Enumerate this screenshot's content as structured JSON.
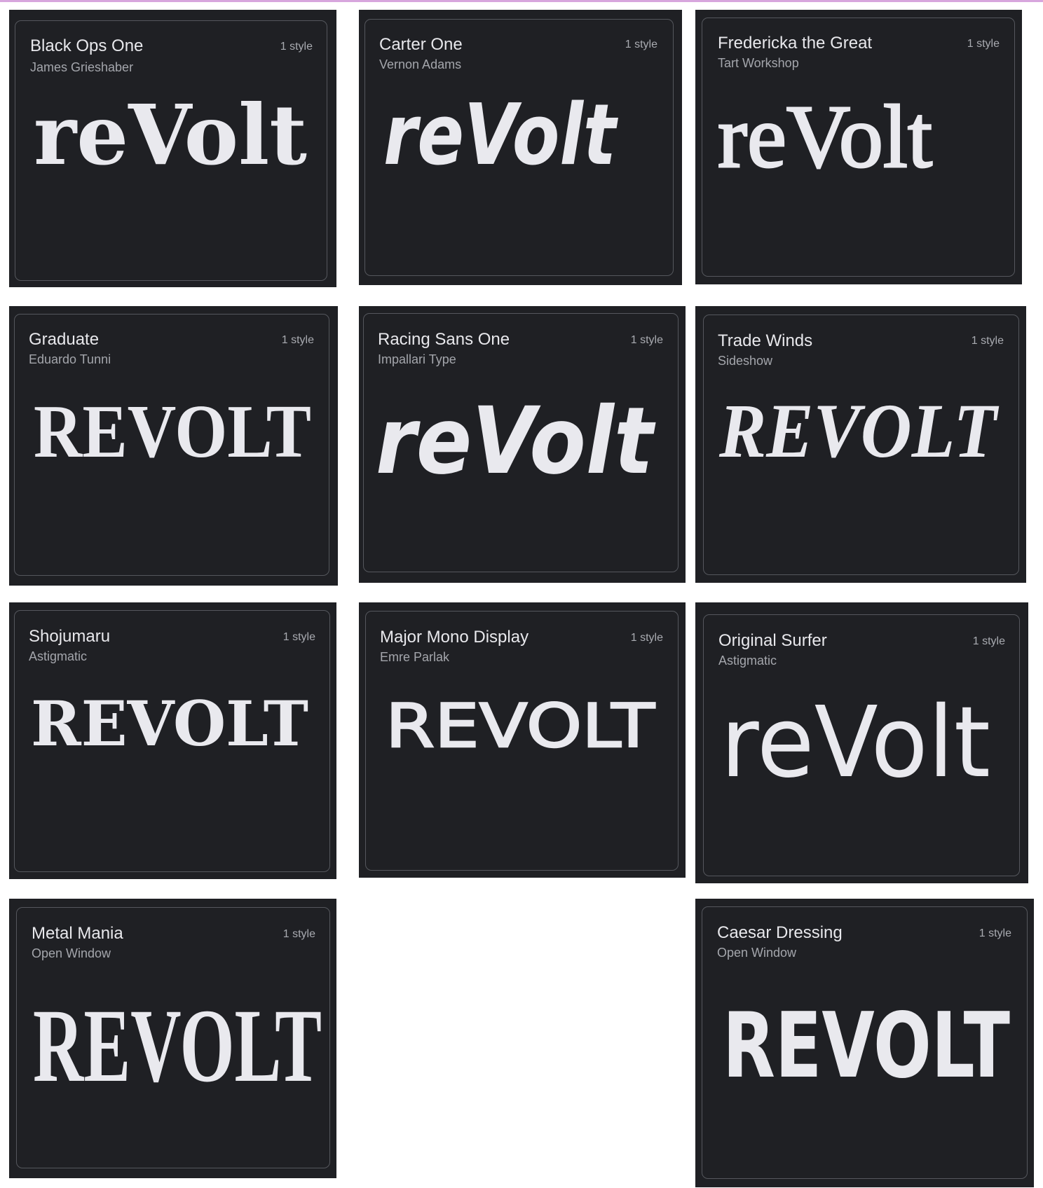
{
  "sample_text_lower": "reVolt",
  "sample_text_upper": "REVOLT",
  "colors": {
    "card_bg": "#1f2024",
    "border": "#55575d",
    "sample": "#e9e9ee",
    "accent_line": "#d7a6dd"
  },
  "fonts": [
    {
      "name": "Black Ops One",
      "author": "James Grieshaber",
      "styles": "1 style",
      "sample": "reVolt"
    },
    {
      "name": "Carter One",
      "author": "Vernon Adams",
      "styles": "1 style",
      "sample": "reVolt"
    },
    {
      "name": "Fredericka the Great",
      "author": "Tart Workshop",
      "styles": "1 style",
      "sample": "reVolt"
    },
    {
      "name": "Graduate",
      "author": "Eduardo Tunni",
      "styles": "1 style",
      "sample": "REVOLT"
    },
    {
      "name": "Racing Sans One",
      "author": "Impallari Type",
      "styles": "1 style",
      "sample": "reVolt"
    },
    {
      "name": "Trade Winds",
      "author": "Sideshow",
      "styles": "1 style",
      "sample": "REVOLT"
    },
    {
      "name": "Shojumaru",
      "author": "Astigmatic",
      "styles": "1 style",
      "sample": "REVOLT"
    },
    {
      "name": "Major Mono Display",
      "author": "Emre Parlak",
      "styles": "1 style",
      "sample": "REVOLT"
    },
    {
      "name": "Original Surfer",
      "author": "Astigmatic",
      "styles": "1 style",
      "sample": "reVolt"
    },
    {
      "name": "Metal Mania",
      "author": "Open Window",
      "styles": "1 style",
      "sample": "REVOLT"
    },
    {
      "name": "Caesar Dressing",
      "author": "Open Window",
      "styles": "1 style",
      "sample": "REVOLT"
    }
  ]
}
